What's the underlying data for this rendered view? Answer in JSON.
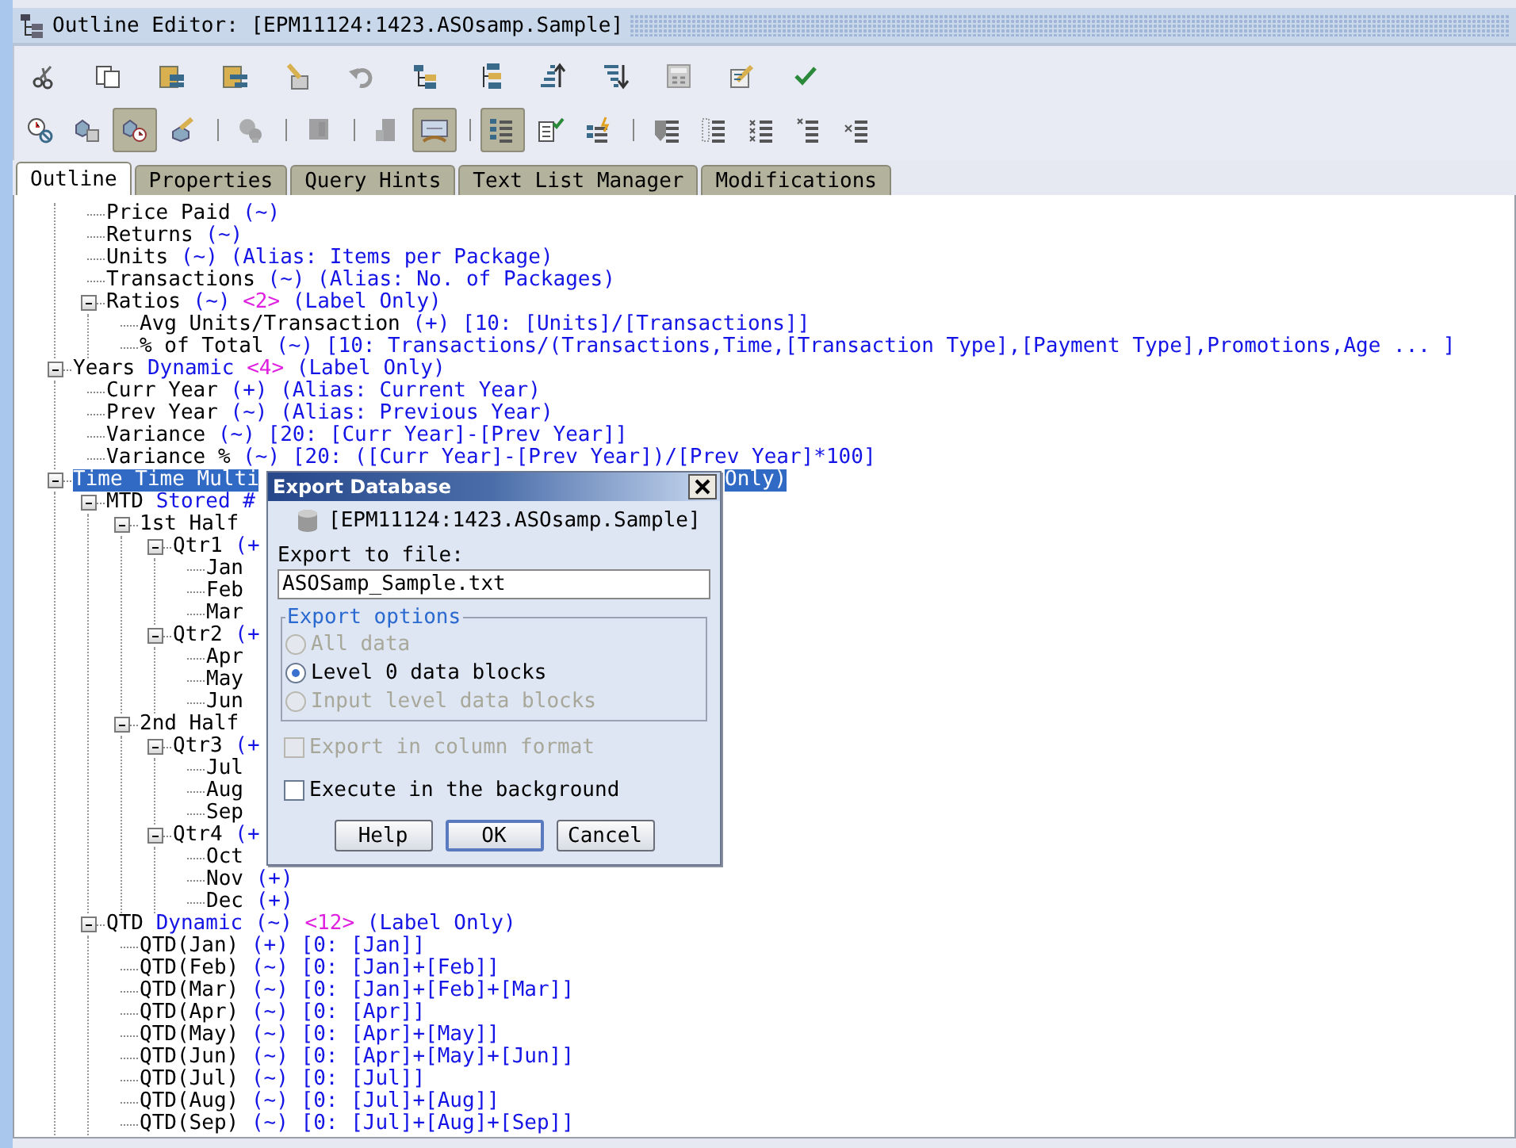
{
  "window": {
    "title": "Outline Editor: [EPM11124:1423.ASOsamp.Sample]"
  },
  "toolbars": [
    {
      "items": [
        {
          "kind": "button"
        },
        {
          "kind": "button"
        },
        {
          "kind": "button"
        },
        {
          "kind": "button"
        },
        {
          "kind": "button"
        },
        {
          "kind": "button"
        },
        {
          "kind": "button"
        },
        {
          "kind": "button"
        },
        {
          "kind": "button"
        },
        {
          "kind": "button"
        },
        {
          "kind": "button"
        },
        {
          "kind": "button"
        },
        {
          "kind": "button"
        }
      ]
    },
    {
      "items": [
        {
          "kind": "toggle",
          "pressed": false
        },
        {
          "kind": "toggle",
          "pressed": false
        },
        {
          "kind": "toggle",
          "pressed": true
        },
        {
          "kind": "toggle",
          "pressed": false
        },
        {
          "kind": "separator"
        },
        {
          "kind": "button",
          "disabled": true
        },
        {
          "kind": "separator"
        },
        {
          "kind": "button",
          "disabled": true
        },
        {
          "kind": "separator"
        },
        {
          "kind": "button",
          "disabled": true
        },
        {
          "kind": "toggle",
          "pressed": true
        },
        {
          "kind": "separator"
        },
        {
          "kind": "toggle",
          "pressed": true
        },
        {
          "kind": "toggle",
          "pressed": false
        },
        {
          "kind": "toggle",
          "pressed": false
        },
        {
          "kind": "separator"
        },
        {
          "kind": "button",
          "disabled": false
        },
        {
          "kind": "button",
          "disabled": false
        },
        {
          "kind": "button",
          "disabled": false
        },
        {
          "kind": "button",
          "disabled": false
        },
        {
          "kind": "button",
          "disabled": false
        }
      ]
    }
  ],
  "tabs": [
    {
      "label": "Outline",
      "selected": true
    },
    {
      "label": "Properties",
      "selected": false
    },
    {
      "label": "Query Hints",
      "selected": false
    },
    {
      "label": "Text List Manager",
      "selected": false
    },
    {
      "label": "Modifications",
      "selected": false
    }
  ],
  "tree": [
    {
      "children": [
        {
          "segments": [
            {
              "kind": "name",
              "text": "Price Paid"
            },
            {
              "kind": "info",
              "text": "(~)"
            }
          ],
          "selected": false
        },
        {
          "segments": [
            {
              "kind": "name",
              "text": "Returns"
            },
            {
              "kind": "info",
              "text": "(~)"
            }
          ],
          "selected": false
        },
        {
          "segments": [
            {
              "kind": "name",
              "text": "Units"
            },
            {
              "kind": "info",
              "text": "(~) (Alias: Items per Package)"
            }
          ],
          "selected": false
        },
        {
          "segments": [
            {
              "kind": "name",
              "text": "Transactions"
            },
            {
              "kind": "info",
              "text": "(~) (Alias: No. of Packages)"
            }
          ],
          "selected": false
        },
        {
          "segments": [
            {
              "kind": "name",
              "text": "Ratios"
            },
            {
              "kind": "info",
              "text": "(~)"
            },
            {
              "kind": "count",
              "text": "<2>"
            },
            {
              "kind": "info",
              "text": "(Label Only)"
            }
          ],
          "selected": false,
          "expanded": true,
          "children": [
            {
              "segments": [
                {
                  "kind": "name",
                  "text": "Avg Units/Transaction"
                },
                {
                  "kind": "info",
                  "text": "(+) [10: [Units]/[Transactions]]"
                }
              ],
              "selected": false
            },
            {
              "segments": [
                {
                  "kind": "name",
                  "text": "% of Total"
                },
                {
                  "kind": "info",
                  "text": "(~) [10: Transactions/(Transactions,Time,[Transaction Type],[Payment Type],Promotions,Age ... ]"
                }
              ],
              "selected": false
            }
          ]
        }
      ]
    },
    {
      "segments": [
        {
          "kind": "name",
          "text": "Years"
        },
        {
          "kind": "info",
          "text": "Dynamic "
        },
        {
          "kind": "count",
          "text": "<4>"
        },
        {
          "kind": "info",
          "text": "(Label Only)"
        }
      ],
      "selected": false,
      "expanded": true,
      "children": [
        {
          "segments": [
            {
              "kind": "name",
              "text": "Curr Year"
            },
            {
              "kind": "info",
              "text": "(+) (Alias: Current Year)"
            }
          ],
          "selected": false
        },
        {
          "segments": [
            {
              "kind": "name",
              "text": "Prev Year"
            },
            {
              "kind": "info",
              "text": "(~) (Alias: Previous Year)"
            }
          ],
          "selected": false
        },
        {
          "segments": [
            {
              "kind": "name",
              "text": "Variance"
            },
            {
              "kind": "info",
              "text": "(~) [20: [Curr Year]-[Prev Year]]"
            }
          ],
          "selected": false
        },
        {
          "segments": [
            {
              "kind": "name",
              "text": "Variance %"
            },
            {
              "kind": "info",
              "text": "(~) [20: ([Curr Year]-[Prev Year])/[Prev Year]*100]"
            }
          ],
          "selected": false
        }
      ]
    },
    {
      "segments": [
        {
          "kind": "name",
          "text": "Time Time Multi"
        },
        {
          "kind": "info",
          "text": "Only)",
          "beyond_dialog": true
        }
      ],
      "selected": true,
      "expanded": true,
      "children": [
        {
          "segments": [
            {
              "kind": "name",
              "text": "MTD"
            },
            {
              "kind": "info",
              "text": "Stored #"
            }
          ],
          "selected": false,
          "expanded": true,
          "children": [
            {
              "segments": [
                {
                  "kind": "name",
                  "text": "1st Half"
                }
              ],
              "selected": false,
              "expanded": true,
              "children": [
                {
                  "segments": [
                    {
                      "kind": "name",
                      "text": "Qtr1"
                    },
                    {
                      "kind": "info",
                      "text": "(+"
                    }
                  ],
                  "selected": false,
                  "expanded": true,
                  "children": [
                    {
                      "segments": [
                        {
                          "kind": "name",
                          "text": "Jan"
                        }
                      ],
                      "selected": false
                    },
                    {
                      "segments": [
                        {
                          "kind": "name",
                          "text": "Feb"
                        }
                      ],
                      "selected": false
                    },
                    {
                      "segments": [
                        {
                          "kind": "name",
                          "text": "Mar"
                        }
                      ],
                      "selected": false
                    }
                  ]
                },
                {
                  "segments": [
                    {
                      "kind": "name",
                      "text": "Qtr2"
                    },
                    {
                      "kind": "info",
                      "text": "(+"
                    }
                  ],
                  "selected": false,
                  "expanded": true,
                  "children": [
                    {
                      "segments": [
                        {
                          "kind": "name",
                          "text": "Apr"
                        }
                      ],
                      "selected": false
                    },
                    {
                      "segments": [
                        {
                          "kind": "name",
                          "text": "May"
                        }
                      ],
                      "selected": false
                    },
                    {
                      "segments": [
                        {
                          "kind": "name",
                          "text": "Jun"
                        }
                      ],
                      "selected": false
                    }
                  ]
                }
              ]
            },
            {
              "segments": [
                {
                  "kind": "name",
                  "text": "2nd Half"
                }
              ],
              "selected": false,
              "expanded": true,
              "children": [
                {
                  "segments": [
                    {
                      "kind": "name",
                      "text": "Qtr3"
                    },
                    {
                      "kind": "info",
                      "text": "(+"
                    }
                  ],
                  "selected": false,
                  "expanded": true,
                  "children": [
                    {
                      "segments": [
                        {
                          "kind": "name",
                          "text": "Jul"
                        }
                      ],
                      "selected": false
                    },
                    {
                      "segments": [
                        {
                          "kind": "name",
                          "text": "Aug"
                        }
                      ],
                      "selected": false
                    },
                    {
                      "segments": [
                        {
                          "kind": "name",
                          "text": "Sep"
                        }
                      ],
                      "selected": false
                    }
                  ]
                },
                {
                  "segments": [
                    {
                      "kind": "name",
                      "text": "Qtr4"
                    },
                    {
                      "kind": "info",
                      "text": "(+"
                    }
                  ],
                  "selected": false,
                  "expanded": true,
                  "children": [
                    {
                      "segments": [
                        {
                          "kind": "name",
                          "text": "Oct"
                        }
                      ],
                      "selected": false
                    },
                    {
                      "segments": [
                        {
                          "kind": "name",
                          "text": "Nov"
                        },
                        {
                          "kind": "info",
                          "text": "(+)"
                        }
                      ],
                      "selected": false
                    },
                    {
                      "segments": [
                        {
                          "kind": "name",
                          "text": "Dec"
                        },
                        {
                          "kind": "info",
                          "text": "(+)"
                        }
                      ],
                      "selected": false
                    }
                  ]
                }
              ]
            }
          ]
        },
        {
          "segments": [
            {
              "kind": "name",
              "text": "QTD"
            },
            {
              "kind": "info",
              "text": "Dynamic  (~)"
            },
            {
              "kind": "count",
              "text": "<12>"
            },
            {
              "kind": "info",
              "text": "(Label Only)"
            }
          ],
          "selected": false,
          "expanded": true,
          "children": [
            {
              "segments": [
                {
                  "kind": "name",
                  "text": "QTD(Jan)"
                },
                {
                  "kind": "info",
                  "text": "(+) [0: [Jan]]"
                }
              ],
              "selected": false
            },
            {
              "segments": [
                {
                  "kind": "name",
                  "text": "QTD(Feb)"
                },
                {
                  "kind": "info",
                  "text": "(~) [0: [Jan]+[Feb]]"
                }
              ],
              "selected": false
            },
            {
              "segments": [
                {
                  "kind": "name",
                  "text": "QTD(Mar)"
                },
                {
                  "kind": "info",
                  "text": "(~) [0: [Jan]+[Feb]+[Mar]]"
                }
              ],
              "selected": false
            },
            {
              "segments": [
                {
                  "kind": "name",
                  "text": "QTD(Apr)"
                },
                {
                  "kind": "info",
                  "text": "(~) [0: [Apr]]"
                }
              ],
              "selected": false
            },
            {
              "segments": [
                {
                  "kind": "name",
                  "text": "QTD(May)"
                },
                {
                  "kind": "info",
                  "text": "(~) [0: [Apr]+[May]]"
                }
              ],
              "selected": false
            },
            {
              "segments": [
                {
                  "kind": "name",
                  "text": "QTD(Jun)"
                },
                {
                  "kind": "info",
                  "text": "(~) [0: [Apr]+[May]+[Jun]]"
                }
              ],
              "selected": false
            },
            {
              "segments": [
                {
                  "kind": "name",
                  "text": "QTD(Jul)"
                },
                {
                  "kind": "info",
                  "text": "(~) [0: [Jul]]"
                }
              ],
              "selected": false
            },
            {
              "segments": [
                {
                  "kind": "name",
                  "text": "QTD(Aug)"
                },
                {
                  "kind": "info",
                  "text": "(~) [0: [Jul]+[Aug]]"
                }
              ],
              "selected": false
            },
            {
              "segments": [
                {
                  "kind": "name",
                  "text": "QTD(Sep)"
                },
                {
                  "kind": "info",
                  "text": "(~) [0: [Jul]+[Aug]+[Sep]]"
                }
              ],
              "selected": false
            }
          ]
        }
      ]
    }
  ],
  "dialog": {
    "title": "Export Database",
    "database": "[EPM11124:1423.ASOsamp.Sample]",
    "file_label": "Export to file:",
    "file_value": "ASOSamp_Sample.txt",
    "options_title": "Export options",
    "options": [
      {
        "label": "All data",
        "selected": false,
        "disabled": true
      },
      {
        "label": "Level 0 data blocks",
        "selected": true,
        "disabled": false
      },
      {
        "label": "Input level data blocks",
        "selected": false,
        "disabled": true
      }
    ],
    "checks": [
      {
        "label": "Export in column format",
        "checked": false,
        "disabled": true
      },
      {
        "label": "Execute in the background",
        "checked": false,
        "disabled": false
      }
    ],
    "buttons": [
      {
        "label": "Help",
        "default": false
      },
      {
        "label": "OK",
        "default": true
      },
      {
        "label": "Cancel",
        "default": false
      }
    ]
  }
}
